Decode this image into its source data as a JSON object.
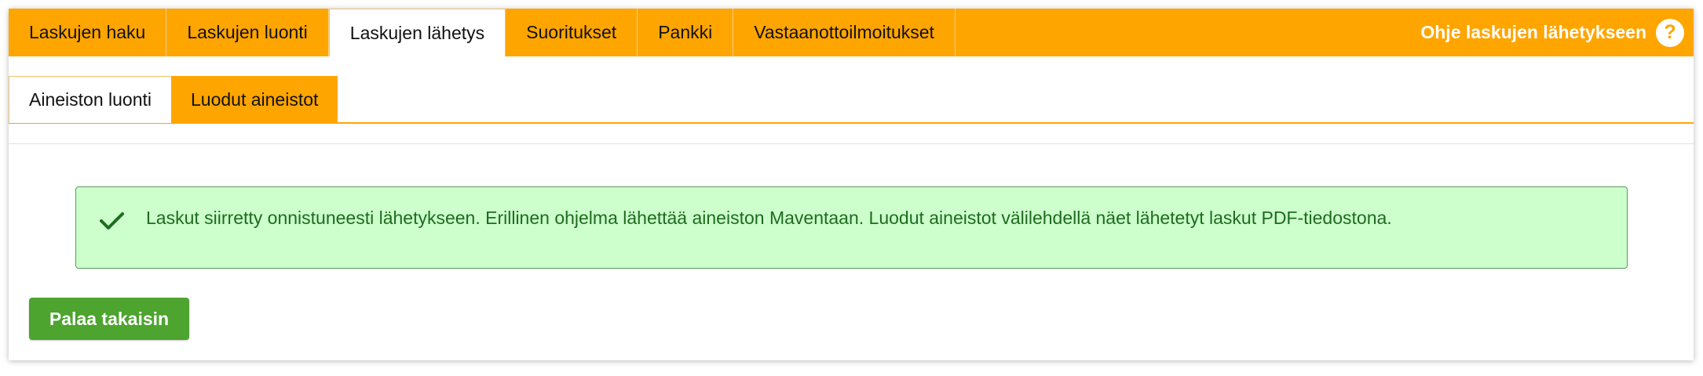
{
  "top_tabs": [
    {
      "label": "Laskujen haku"
    },
    {
      "label": "Laskujen luonti"
    },
    {
      "label": "Laskujen lähetys",
      "active": true
    },
    {
      "label": "Suoritukset"
    },
    {
      "label": "Pankki"
    },
    {
      "label": "Vastaanottoilmoitukset"
    }
  ],
  "help": {
    "label": "Ohje laskujen lähetykseen",
    "icon": "?"
  },
  "sub_tabs": [
    {
      "label": "Aineiston luonti"
    },
    {
      "label": "Luodut aineistot"
    }
  ],
  "alert": {
    "message": "Laskut siirretty onnistuneesti lähetykseen. Erillinen ohjelma lähettää aineiston Maventaan. Luodut aineistot välilehdellä näet lähetetyt laskut PDF-tiedostona.",
    "icon": "check-icon"
  },
  "actions": {
    "back_label": "Palaa takaisin"
  },
  "colors": {
    "accent_orange": "#FFA500",
    "success_bg": "#CCFFCC",
    "success_text": "#1E6B1E",
    "button_green": "#4DA42F"
  }
}
